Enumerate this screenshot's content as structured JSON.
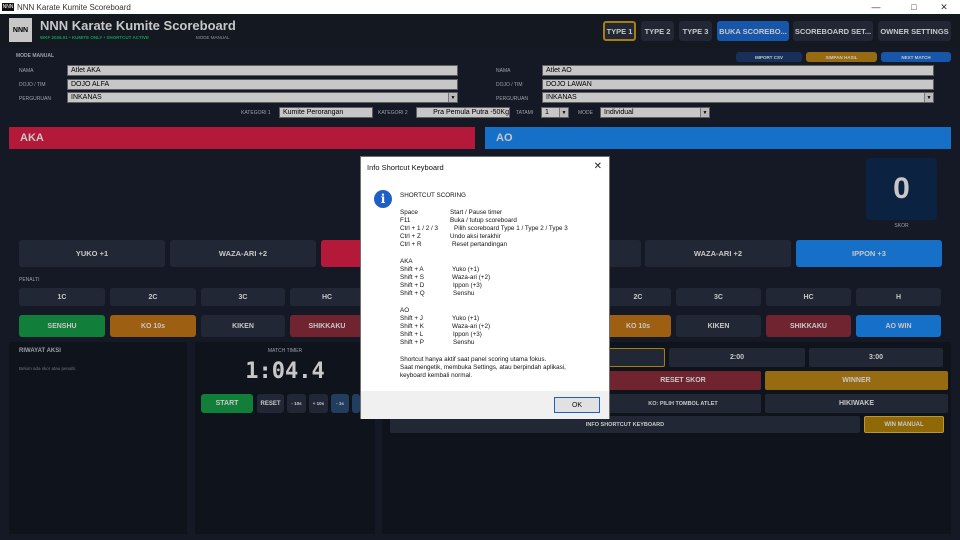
{
  "window": {
    "title": "NNN Karate Kumite Scoreboard",
    "logo": "NNN",
    "controls": [
      "minimize-icon",
      "maximize-icon",
      "close-icon"
    ]
  },
  "header": {
    "logo": "NNN",
    "title": "NNN Karate Kumite Scoreboard",
    "subtitle": "WKF 2026.01 • KUMITE ONLY • SHORTCUT ACTIVE",
    "mode": "MODE MANUAL",
    "buttons": {
      "type1": "TYPE 1",
      "type2": "TYPE 2",
      "type3": "TYPE 3",
      "buka": "BUKA SCOREBO...",
      "settings": "SCOREBOARD SET...",
      "owner": "OWNER SETTINGS"
    }
  },
  "toolbar": {
    "mode_manual": "MODE MANUAL",
    "import_csv": "IMPORT CSV",
    "simpan_hasil": "SIMPAN HASIL",
    "next_match": "NEXT MATCH"
  },
  "labels": {
    "nama": "NAMA",
    "dojo": "DOJO / TIM",
    "perguruan": "PERGURUAN",
    "kategori1": "KATEGORI 1",
    "kategori2": "KATEGORI 2",
    "tatami": "TATAMI",
    "mode": "MODE"
  },
  "aka_form": {
    "nama": "Atlet AKA",
    "dojo": "DOJO ALFA",
    "perguruan": "INKANAS"
  },
  "ao_form": {
    "nama": "Atlet AO",
    "dojo": "DOJO LAWAN",
    "perguruan": "INKANAS"
  },
  "category": {
    "kategori1": "Kumite Perorangan",
    "kategori2": "Pra Pemula Putra -50Kg",
    "tatami": "1",
    "mode": "Individual"
  },
  "aka": {
    "name": "AKA",
    "buttons": {
      "yuko": "YUKO  +1",
      "wazaari": "WAZA-ARI  +2"
    },
    "penalti_label": "PENALTI",
    "penalti": [
      "1C",
      "2C",
      "3C",
      "HC"
    ],
    "actions": {
      "senshu": "SENSHU",
      "ko": "KO 10s",
      "kiken": "KIKEN",
      "shikkaku": "SHIKKAKU"
    }
  },
  "ao": {
    "name": "AO",
    "score": "0",
    "score_label": "SKOR",
    "buttons": {
      "wazaari": "WAZA-ARI  +2",
      "ippon": "IPPON  +3"
    },
    "penalti": [
      "2C",
      "3C",
      "HC",
      "H"
    ],
    "actions": {
      "ko": "KO 10s",
      "kiken": "KIKEN",
      "shikkaku": "SHIKKAKU",
      "ao_win": "AO WIN"
    }
  },
  "history": {
    "title": "RIWAYAT AKSI",
    "empty": "Belum ada skor atau penalti."
  },
  "timer": {
    "label": "MATCH TIMER",
    "value": "1:04.4",
    "start": "START",
    "reset": "RESET",
    "minus10": "- 10s",
    "plus10": "+ 10s",
    "minus1": "- 1s"
  },
  "right_controls": {
    "t200": "2:00",
    "t300": "3:00",
    "reset_skor": "RESET SKOR",
    "winner": "WINNER",
    "ko_pilih": "KO: PILIH TOMBOL ATLET",
    "hikiwake": "HIKIWAKE",
    "info_shortcut": "INFO SHORTCUT KEYBOARD",
    "win_manual": "WIN MANUAL"
  },
  "dialog": {
    "title": "Info Shortcut Keyboard",
    "heading": "SHORTCUT SCORING",
    "general": [
      {
        "key": "Space",
        "desc": "Start / Pause timer"
      },
      {
        "key": "F11",
        "desc": "Buka / tutup scoreboard"
      },
      {
        "key": "Ctrl + 1 / 2 / 3",
        "desc": "Pilih scoreboard Type 1 / Type 2 / Type 3"
      },
      {
        "key": "Ctrl + Z",
        "desc": "Undo aksi terakhir"
      },
      {
        "key": "Ctrl + R",
        "desc": "Reset pertandingan"
      }
    ],
    "aka_heading": "AKA",
    "aka": [
      {
        "key": "Shift + A",
        "desc": "Yuko (+1)"
      },
      {
        "key": "Shift + S",
        "desc": "Waza-ari (+2)"
      },
      {
        "key": "Shift + D",
        "desc": "Ippon (+3)"
      },
      {
        "key": "Shift + Q",
        "desc": "Senshu"
      }
    ],
    "ao_heading": "AO",
    "ao": [
      {
        "key": "Shift + J",
        "desc": "Yuko (+1)"
      },
      {
        "key": "Shift + K",
        "desc": "Waza-ari (+2)"
      },
      {
        "key": "Shift + L",
        "desc": "Ippon (+3)"
      },
      {
        "key": "Shift + P",
        "desc": "Senshu"
      }
    ],
    "note": [
      "Shortcut hanya aktif saat panel scoring utama fokus.",
      "Saat mengetik, membuka Settings, atau berpindah aplikasi,",
      "keyboard kembali normal."
    ],
    "ok": "OK"
  },
  "colors": {
    "aka": "#e8214a",
    "ao": "#1e90ff",
    "senshu": "#16a34a",
    "ko": "#c97a16",
    "shikkaku": "#8f2f3e",
    "gold": "#d4a017",
    "bg": "#1b2130"
  }
}
